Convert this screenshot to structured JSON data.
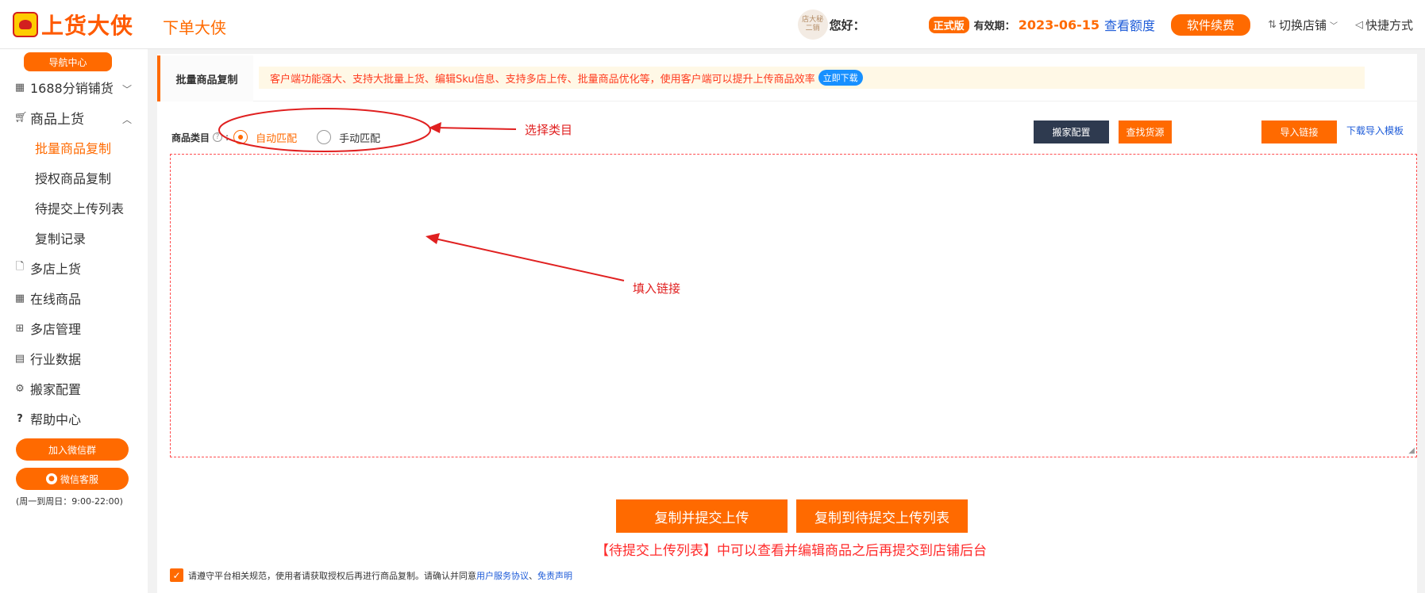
{
  "header": {
    "logo_text": "上货大侠",
    "title": "下单大侠",
    "avatar_text": "店大秘 二销",
    "greeting": "您好：",
    "edition_badge": "正式版",
    "expire_label": "有效期：",
    "expire_date": "2023-06-15",
    "quota_link": "查看额度",
    "renew_button": "软件续费",
    "switch_store": "切换店铺",
    "shortcut": "快捷方式"
  },
  "sidebar": {
    "nav_center": "导航中心",
    "items": [
      {
        "label": "1688分销铺货",
        "icon": "grid-icon"
      },
      {
        "label": "商品上货",
        "icon": "cart-icon"
      },
      {
        "label": "多店上货",
        "icon": "file-icon"
      },
      {
        "label": "在线商品",
        "icon": "grid-icon"
      },
      {
        "label": "多店管理",
        "icon": "apps-icon"
      },
      {
        "label": "行业数据",
        "icon": "clipboard-icon"
      },
      {
        "label": "搬家配置",
        "icon": "gear-icon"
      },
      {
        "label": "帮助中心",
        "icon": "question-icon"
      }
    ],
    "sub_items": [
      "批量商品复制",
      "授权商品复制",
      "待提交上传列表",
      "复制记录"
    ],
    "join_wechat": "加入微信群",
    "wechat_service": "微信客服",
    "hours": "(周一到周日：9:00-22:00)"
  },
  "main": {
    "active_tab": "批量商品复制",
    "notice": "客户端功能强大、支持大批量上货、编辑Sku信息、支持多店上传、批量商品优化等，使用客户端可以提升上传商品效率",
    "download_btn": "立即下载",
    "category_label": "商品类目",
    "radio_auto": "自动匹配",
    "radio_manual": "手动匹配",
    "btn_move_config": "搬家配置",
    "btn_find_source": "查找货源",
    "btn_import_link": "导入链接",
    "download_template": "下载导入模板",
    "submit_upload": "复制并提交上传",
    "submit_pending": "复制到待提交上传列表",
    "tip": "【待提交上传列表】中可以查看并编辑商品之后再提交到店铺后台",
    "agree_text": "请遵守平台相关规范，使用者请获取授权后再进行商品复制。请确认并同意",
    "agree_link1": "用户服务协议",
    "agree_sep": "、",
    "agree_link2": "免责声明"
  },
  "annotations": {
    "select_category": "选择类目",
    "fill_link": "填入链接"
  }
}
